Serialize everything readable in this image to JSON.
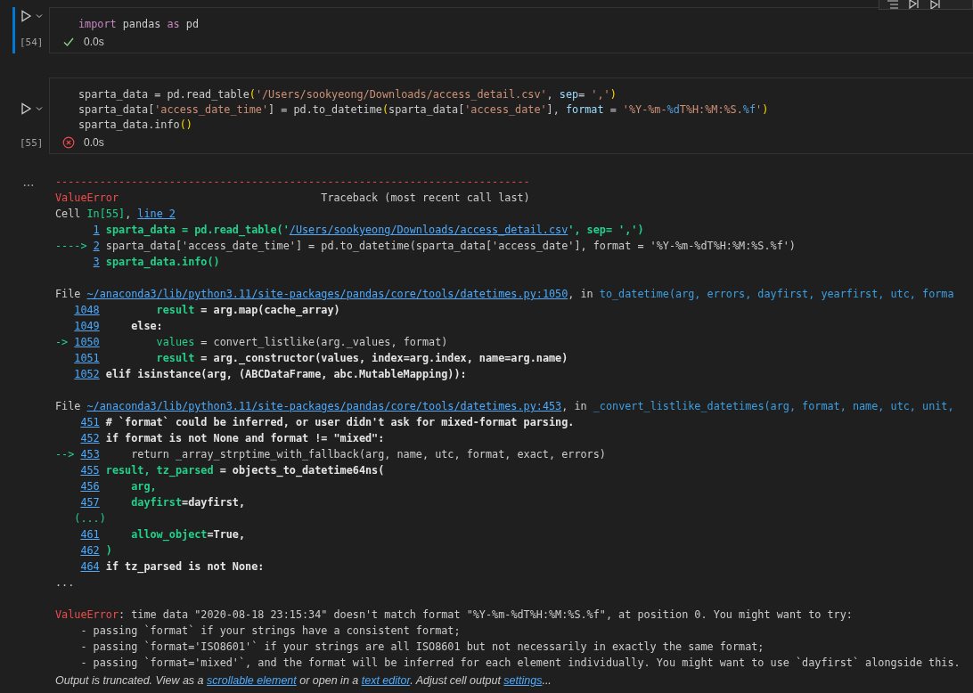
{
  "cells": [
    {
      "focused": true,
      "prompt": "[54]",
      "succeeded": true,
      "time": "0.0s",
      "code": [
        [
          {
            "kind": "kw",
            "text": "import"
          },
          {
            "kind": "plain",
            "text": " pandas "
          },
          {
            "kind": "kw",
            "text": "as"
          },
          {
            "kind": "plain",
            "text": " pd"
          }
        ]
      ]
    },
    {
      "focused": false,
      "prompt": "[55]",
      "succeeded": false,
      "time": "0.0s",
      "code": [
        [
          {
            "kind": "plain",
            "text": "sparta_data = pd.read_table"
          },
          {
            "kind": "paren",
            "text": "("
          },
          {
            "kind": "str",
            "text": "'/Users/sookyeong/Downloads/access_detail.csv'"
          },
          {
            "kind": "plain",
            "text": ", "
          },
          {
            "kind": "param",
            "text": "sep"
          },
          {
            "kind": "plain",
            "text": "= "
          },
          {
            "kind": "str",
            "text": "','"
          },
          {
            "kind": "paren",
            "text": ")"
          }
        ],
        [
          {
            "kind": "plain",
            "text": "sparta_data["
          },
          {
            "kind": "str",
            "text": "'access_date_time'"
          },
          {
            "kind": "plain",
            "text": "] = pd.to_datetime"
          },
          {
            "kind": "paren",
            "text": "("
          },
          {
            "kind": "plain",
            "text": "sparta_data["
          },
          {
            "kind": "str",
            "text": "'access_date'"
          },
          {
            "kind": "plain",
            "text": "], "
          },
          {
            "kind": "param",
            "text": "format"
          },
          {
            "kind": "plain",
            "text": " = "
          },
          {
            "kind": "str",
            "text": "'%Y-%m-"
          },
          {
            "kind": "esc",
            "text": "%d"
          },
          {
            "kind": "str",
            "text": "T%H:%M:%S."
          },
          {
            "kind": "esc",
            "text": "%f"
          },
          {
            "kind": "str",
            "text": "'"
          },
          {
            "kind": "paren",
            "text": ")"
          }
        ],
        [
          {
            "kind": "plain",
            "text": "sparta_data.info"
          },
          {
            "kind": "paren",
            "text": "()"
          }
        ]
      ]
    }
  ],
  "output": {
    "blocks": [
      [
        [
          {
            "kind": "red",
            "text": "---------------------------------------------------------------------------"
          }
        ],
        [
          {
            "kind": "red",
            "text": "ValueError"
          },
          {
            "kind": "plain",
            "text": "                                Traceback (most recent call last)"
          }
        ],
        [
          {
            "kind": "plain",
            "text": "Cell "
          },
          {
            "kind": "green",
            "text": "In[55]"
          },
          {
            "kind": "plain",
            "text": ", "
          },
          {
            "kind": "link",
            "text": "line 2"
          }
        ],
        [
          {
            "kind": "link",
            "text": "1"
          },
          {
            "kind": "greenbold",
            "text": " sparta_data = pd.read_table('"
          },
          {
            "kind": "link",
            "text": "/Users/sookyeong/Downloads/access_detail.csv"
          },
          {
            "kind": "greenbold",
            "text": "', sep= ',')"
          }
        ],
        [
          {
            "kind": "arrow",
            "text": "----> "
          },
          {
            "kind": "link",
            "text": "2"
          },
          {
            "kind": "plain",
            "text": " sparta_data['access_date_time'] = pd.to_datetime(sparta_data['access_date'], format = '%Y-%m-%dT%H:%M:%S.%f')"
          }
        ],
        [
          {
            "kind": "link",
            "text": "3"
          },
          {
            "kind": "greenbold",
            "text": " sparta_data.info()"
          }
        ]
      ],
      [
        [
          {
            "kind": "plain",
            "text": "File "
          },
          {
            "kind": "link",
            "text": "~/anaconda3/lib/python3.11/site-packages/pandas/core/tools/datetimes.py:1050"
          },
          {
            "kind": "plain",
            "text": ", in "
          },
          {
            "kind": "func",
            "text": "to_datetime(arg, errors, dayfirst, yearfirst, utc, forma"
          }
        ],
        [
          {
            "kind": "link",
            "text": "1048"
          },
          {
            "kind": "greenbold",
            "text": "         result"
          },
          {
            "kind": "bold",
            "text": " = arg.map(cache_array)"
          }
        ],
        [
          {
            "kind": "link",
            "text": "1049"
          },
          {
            "kind": "bold",
            "text": "     else:"
          }
        ],
        [
          {
            "kind": "arrow",
            "text": "-> "
          },
          {
            "kind": "link",
            "text": "1050"
          },
          {
            "kind": "green",
            "text": "         values"
          },
          {
            "kind": "plain",
            "text": " = convert_listlike(arg._values, format)"
          }
        ],
        [
          {
            "kind": "link",
            "text": "1051"
          },
          {
            "kind": "greenbold",
            "text": "         result"
          },
          {
            "kind": "bold",
            "text": " = arg._constructor(values, index=arg.index, name=arg.name)"
          }
        ],
        [
          {
            "kind": "link",
            "text": "1052"
          },
          {
            "kind": "bold",
            "text": " elif isinstance(arg, (ABCDataFrame, abc.MutableMapping)):"
          }
        ]
      ],
      [
        [
          {
            "kind": "plain",
            "text": "File "
          },
          {
            "kind": "link",
            "text": "~/anaconda3/lib/python3.11/site-packages/pandas/core/tools/datetimes.py:453"
          },
          {
            "kind": "plain",
            "text": ", in "
          },
          {
            "kind": "func",
            "text": "_convert_listlike_datetimes(arg, format, name, utc, unit,"
          }
        ],
        [
          {
            "kind": "link",
            "text": "451"
          },
          {
            "kind": "bold",
            "text": " # `format` could be inferred, or user didn't ask for mixed-format parsing."
          }
        ],
        [
          {
            "kind": "link",
            "text": "452"
          },
          {
            "kind": "bold",
            "text": " if format is not None and format != \"mixed\":"
          }
        ],
        [
          {
            "kind": "arrow",
            "text": "--> "
          },
          {
            "kind": "link",
            "text": "453"
          },
          {
            "kind": "plain",
            "text": "     return _array_strptime_with_fallback(arg, name, utc, format, exact, errors)"
          }
        ],
        [
          {
            "kind": "link",
            "text": "455"
          },
          {
            "kind": "greenbold",
            "text": " result, tz_parsed"
          },
          {
            "kind": "bold",
            "text": " = objects_to_datetime64ns("
          }
        ],
        [
          {
            "kind": "link",
            "text": "456"
          },
          {
            "kind": "greenbold",
            "text": "     arg,"
          }
        ],
        [
          {
            "kind": "link",
            "text": "457"
          },
          {
            "kind": "greenbold",
            "text": "     dayfirst"
          },
          {
            "kind": "bold",
            "text": "=dayfirst,"
          }
        ],
        [
          {
            "kind": "green",
            "text": "   (...)"
          }
        ],
        [
          {
            "kind": "link",
            "text": "461"
          },
          {
            "kind": "greenbold",
            "text": "     allow_object"
          },
          {
            "kind": "bold",
            "text": "=True,"
          }
        ],
        [
          {
            "kind": "link",
            "text": "462"
          },
          {
            "kind": "greenbold",
            "text": " )"
          }
        ],
        [
          {
            "kind": "link",
            "text": "464"
          },
          {
            "kind": "bold",
            "text": " if tz_parsed is not None:"
          }
        ],
        [
          {
            "kind": "plain",
            "text": "..."
          }
        ]
      ],
      [
        [
          {
            "kind": "red",
            "text": "ValueError"
          },
          {
            "kind": "plain",
            "text": ": time data \"2020-08-18 23:15:34\" doesn't match format \"%Y-%m-%dT%H:%M:%S.%f\", at position 0. You might want to try:"
          }
        ],
        [
          {
            "kind": "plain",
            "text": "    - passing `format` if your strings have a consistent format;"
          }
        ],
        [
          {
            "kind": "plain",
            "text": "    - passing `format='ISO8601'` if your strings are all ISO8601 but not necessarily in exactly the same format;"
          }
        ],
        [
          {
            "kind": "plain",
            "text": "    - passing `format='mixed'`, and the format will be inferred for each element individually. You might want to use `dayfirst` alongside this."
          }
        ]
      ]
    ],
    "notice": [
      {
        "kind": "text",
        "text": "Output is truncated. View as a "
      },
      {
        "kind": "link",
        "text": "scrollable element"
      },
      {
        "kind": "text",
        "text": " or open in a "
      },
      {
        "kind": "link",
        "text": "text editor"
      },
      {
        "kind": "text",
        "text": ". Adjust cell output "
      },
      {
        "kind": "link",
        "text": "settings"
      },
      {
        "kind": "text",
        "text": "..."
      }
    ]
  }
}
